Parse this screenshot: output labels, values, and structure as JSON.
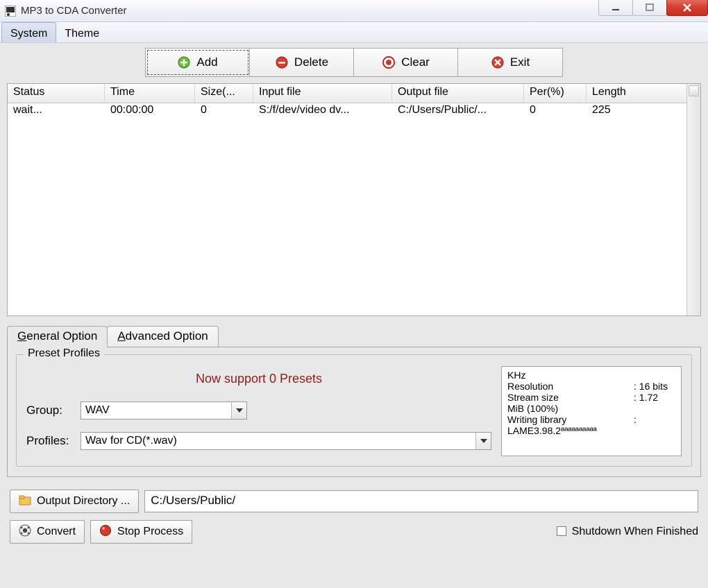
{
  "title": "MP3 to CDA Converter",
  "menu": {
    "system": "System",
    "theme": "Theme"
  },
  "toolbar": {
    "add": "Add",
    "delete": "Delete",
    "clear": "Clear",
    "exit": "Exit"
  },
  "columns": {
    "status": "Status",
    "time": "Time",
    "size": "Size(...",
    "input": "Input file",
    "output": "Output file",
    "per": "Per(%)",
    "length": "Length"
  },
  "rows": [
    {
      "status": "wait...",
      "time": "00:00:00",
      "size": "0",
      "input": "S:/f/dev/video dv...",
      "output": "C:/Users/Public/...",
      "per": "0",
      "length": "225"
    }
  ],
  "tabs": {
    "general_pre": "G",
    "general_rest": "eneral Option",
    "advanced_pre": "A",
    "advanced_rest": "dvanced Option"
  },
  "preset": {
    "legend": "Preset Profiles",
    "msg": "Now support 0 Presets",
    "group_label": "Group:",
    "group_value": "WAV",
    "profiles_label": "Profiles:",
    "profiles_value": "Wav for CD(*.wav)"
  },
  "info": {
    "labels": "KHz\nResolution\nStream size\nMiB (100%)\nWriting library\nLAME3.98.2ªªªªªªªªªª",
    "values": "\n: 16 bits\n: 1.72\n\n:"
  },
  "output": {
    "btn": "Output Directory ...",
    "path": "C:/Users/Public/"
  },
  "actions": {
    "convert": "Convert",
    "stop": "Stop Process",
    "shutdown": "Shutdown When Finished"
  }
}
